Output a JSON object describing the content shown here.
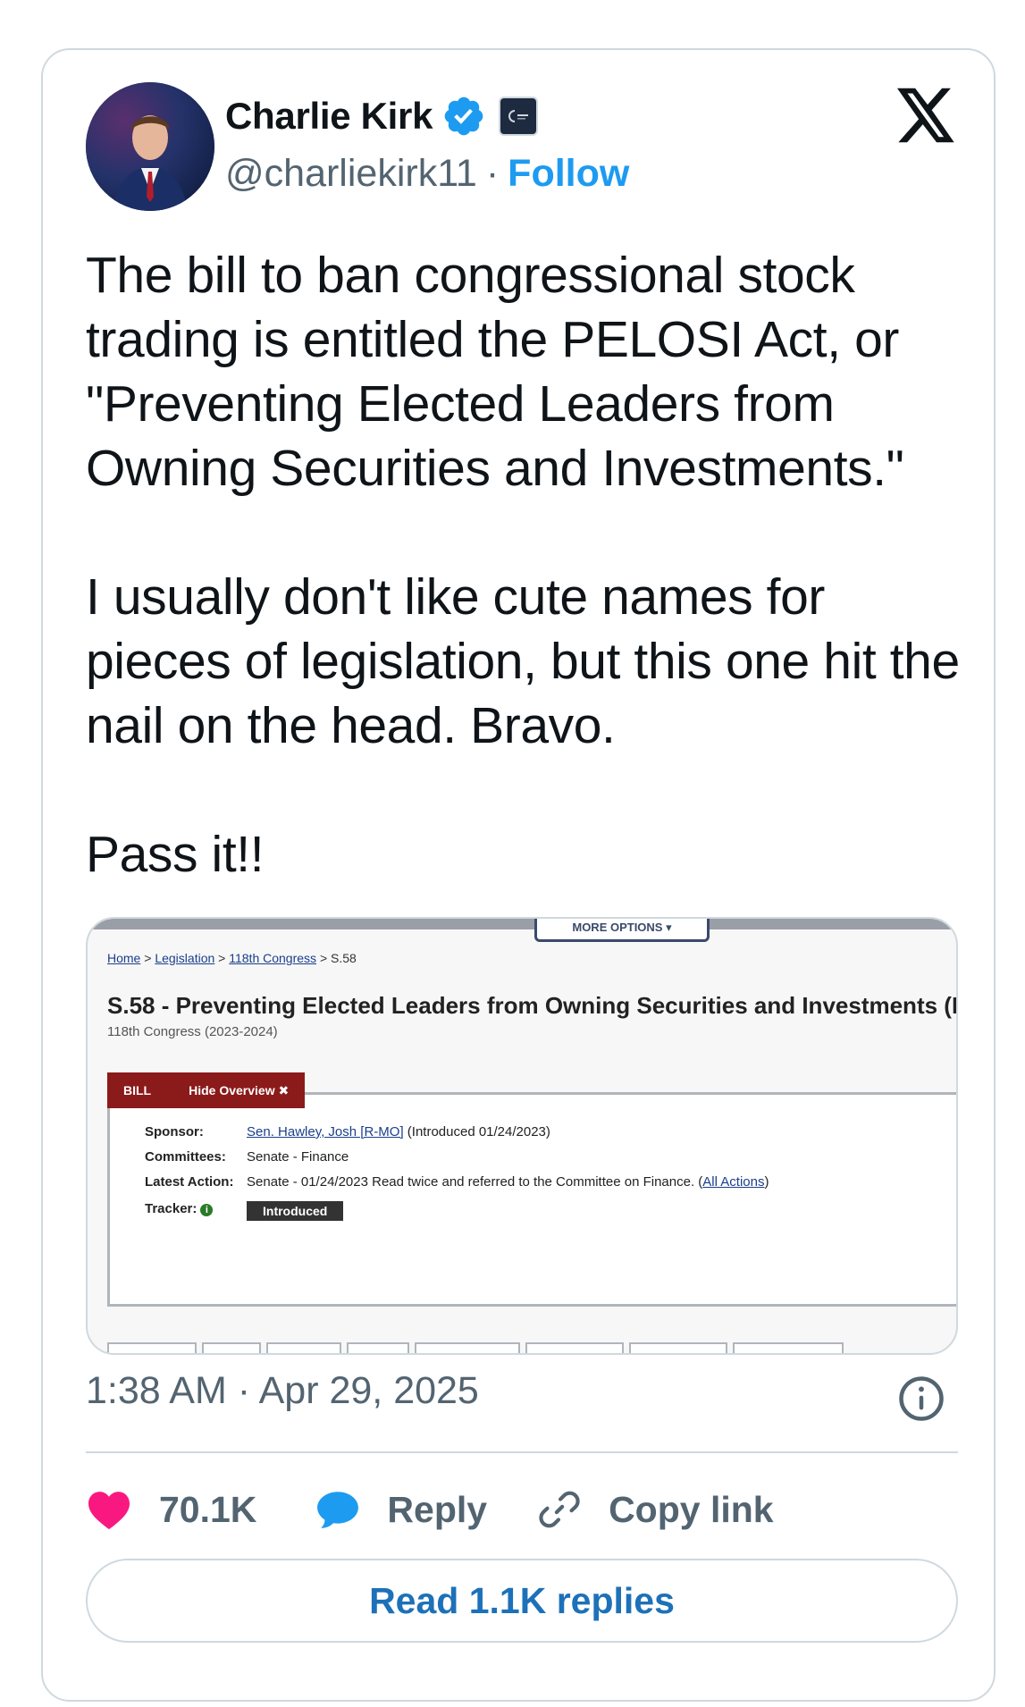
{
  "user": {
    "name": "Charlie Kirk",
    "handle": "@charliekirk11",
    "separator": "·",
    "follow_label": "Follow"
  },
  "tweet": {
    "paragraphs": [
      "The bill to ban congressional stock trading is entitled the PELOSI Act, or \"Preventing Elected Leaders from Owning Securities and Investments.\"",
      "I usually don't like cute names for pieces of legislation, but this one hit the nail on the head. Bravo.",
      "Pass it!!"
    ],
    "timestamp": "1:38 AM · Apr 29, 2025"
  },
  "media": {
    "more_options": "MORE OPTIONS ▾",
    "breadcrumb": [
      "Home",
      "Legislation",
      "118th Congress",
      "S.58"
    ],
    "crumb_sep": ">",
    "bill_title": "S.58 - Preventing Elected Leaders from Owning Securities and Investments (P",
    "congress": "118th Congress (2023-2024)",
    "tab_bill": "BILL",
    "tab_hide": "Hide Overview ✖",
    "sponsor_label": "Sponsor:",
    "sponsor_link": "Sen. Hawley, Josh [R-MO]",
    "sponsor_rest": " (Introduced 01/24/2023)",
    "committees_label": "Committees:",
    "committees_value": "Senate - Finance",
    "latest_label": "Latest Action:",
    "latest_value": "Senate - 01/24/2023 Read twice and referred to the Committee on Finance.  (",
    "latest_link": "All Actions",
    "latest_close": ")",
    "tracker_label": "Tracker:",
    "tracker_status": "Introduced"
  },
  "actions": {
    "likes": "70.1K",
    "reply_label": "Reply",
    "copy_label": "Copy link",
    "read_replies": "Read 1.1K replies"
  },
  "colors": {
    "accent": "#1d9bf0",
    "like": "#f91880",
    "reply_icon": "#1d9bf0",
    "bill_tab": "#8b1a1a"
  },
  "icons": {
    "verified": "verified-badge-icon",
    "affiliation": "affiliation-badge-icon",
    "x_logo": "x-logo-icon",
    "info": "info-icon",
    "like": "heart-icon",
    "reply": "speech-bubble-icon",
    "copy": "link-icon"
  }
}
